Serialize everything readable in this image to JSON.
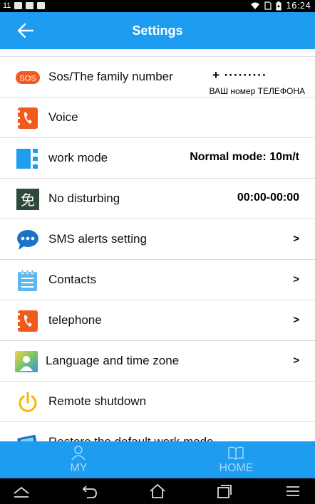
{
  "status_bar": {
    "notification_count": "11",
    "time": "16:24"
  },
  "app_bar": {
    "title": "Settings",
    "back_icon": "arrow-left-icon"
  },
  "settings": [
    {
      "icon": "sos-icon",
      "icon_text": "SOS",
      "label": "Sos/The family number",
      "number": "+ ·········",
      "sub": "ВАШ номер ТЕЛЕФОНА"
    },
    {
      "icon": "voice-icon",
      "label": "Voice"
    },
    {
      "icon": "work-mode-icon",
      "label": "work mode",
      "value": "Normal mode: 10m/t"
    },
    {
      "icon": "no-disturb-icon",
      "icon_text": "免",
      "label": "No disturbing",
      "value": "00:00-00:00"
    },
    {
      "icon": "sms-bubble-icon",
      "label": "SMS alerts setting",
      "arrow": ">"
    },
    {
      "icon": "contacts-icon",
      "label": "Contacts",
      "arrow": ">"
    },
    {
      "icon": "telephone-icon",
      "label": "telephone",
      "arrow": ">"
    },
    {
      "icon": "language-icon",
      "label": "Language and time zone",
      "arrow": ">"
    },
    {
      "icon": "power-icon",
      "label": "Remote shutdown"
    },
    {
      "icon": "restore-icon",
      "label": "Restore the default work mode"
    }
  ],
  "tabs": [
    {
      "label": "MY",
      "icon": "person-icon"
    },
    {
      "label": "HOME",
      "icon": "book-icon"
    }
  ],
  "colors": {
    "primary": "#1e9cf0",
    "tab_text": "#a9d6f7",
    "sos_orange": "#f05a1e",
    "work_mode_blue": "#1e9cf0",
    "no_disturb_green": "#2e4a3a",
    "power_yellow": "#f5b800"
  }
}
